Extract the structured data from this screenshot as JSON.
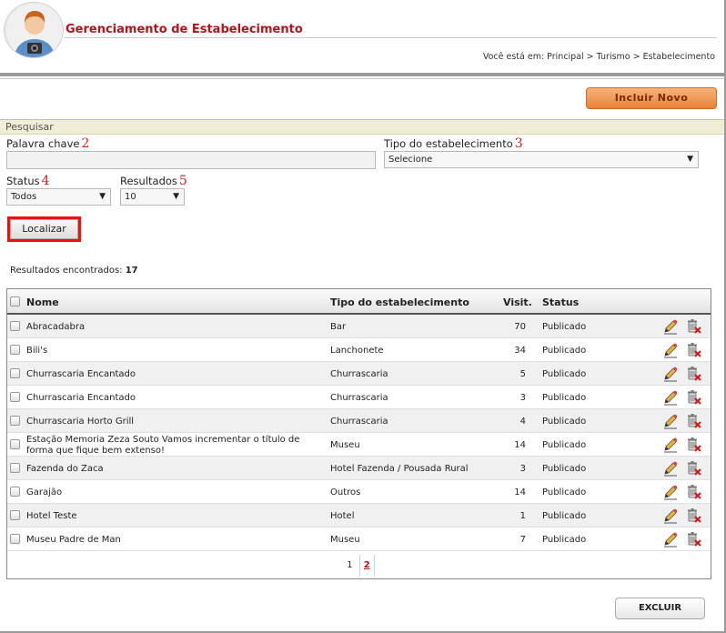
{
  "header": {
    "title": "Gerenciamento de Estabelecimento",
    "breadcrumb": "Você está em: Principal > Turismo > Estabelecimento"
  },
  "toolbar": {
    "incluir_label": "Incluir Novo"
  },
  "search": {
    "section_title": "Pesquisar",
    "keyword_label": "Palavra chave",
    "keyword_num": "2",
    "keyword_value": "",
    "tipo_label": "Tipo do estabelecimento",
    "tipo_num": "3",
    "tipo_selected": "Selecione",
    "status_label": "Status",
    "status_num": "4",
    "status_selected": "Todos",
    "resultados_label": "Resultados",
    "resultados_num": "5",
    "resultados_selected": "10",
    "localizar_label": "Localizar"
  },
  "results": {
    "label": "Resultados encontrados:",
    "count": "17"
  },
  "table": {
    "headers": {
      "nome": "Nome",
      "tipo": "Tipo do estabelecimento",
      "visit": "Visit.",
      "status": "Status"
    },
    "rows": [
      {
        "nome": "Abracadabra",
        "tipo": "Bar",
        "visit": "70",
        "status": "Publicado"
      },
      {
        "nome": "Bili's",
        "tipo": "Lanchonete",
        "visit": "34",
        "status": "Publicado"
      },
      {
        "nome": "Churrascaria Encantado",
        "tipo": "Churrascaria",
        "visit": "5",
        "status": "Publicado"
      },
      {
        "nome": "Churrascaria Encantado",
        "tipo": "Churrascaria",
        "visit": "3",
        "status": "Publicado"
      },
      {
        "nome": "Churrascaria Horto Grill",
        "tipo": "Churrascaria",
        "visit": "4",
        "status": "Publicado"
      },
      {
        "nome": "Estação Memoria Zeza Souto Vamos incrementar o título de forma que fique bem extenso!",
        "tipo": "Museu",
        "visit": "14",
        "status": "Publicado"
      },
      {
        "nome": "Fazenda do Zaca",
        "tipo": "Hotel Fazenda / Pousada Rural",
        "visit": "3",
        "status": "Publicado"
      },
      {
        "nome": "Garajão",
        "tipo": "Outros",
        "visit": "14",
        "status": "Publicado"
      },
      {
        "nome": "Hotel Teste",
        "tipo": "Hotel",
        "visit": "1",
        "status": "Publicado"
      },
      {
        "nome": "Museu Padre de Man",
        "tipo": "Museu",
        "visit": "7",
        "status": "Publicado"
      }
    ]
  },
  "pager": {
    "pages": [
      "1",
      "2"
    ],
    "current": "2"
  },
  "footer": {
    "excluir_label": "EXCLUIR"
  },
  "icons": {
    "edit": "pencil-icon",
    "delete": "trash-delete-icon"
  }
}
